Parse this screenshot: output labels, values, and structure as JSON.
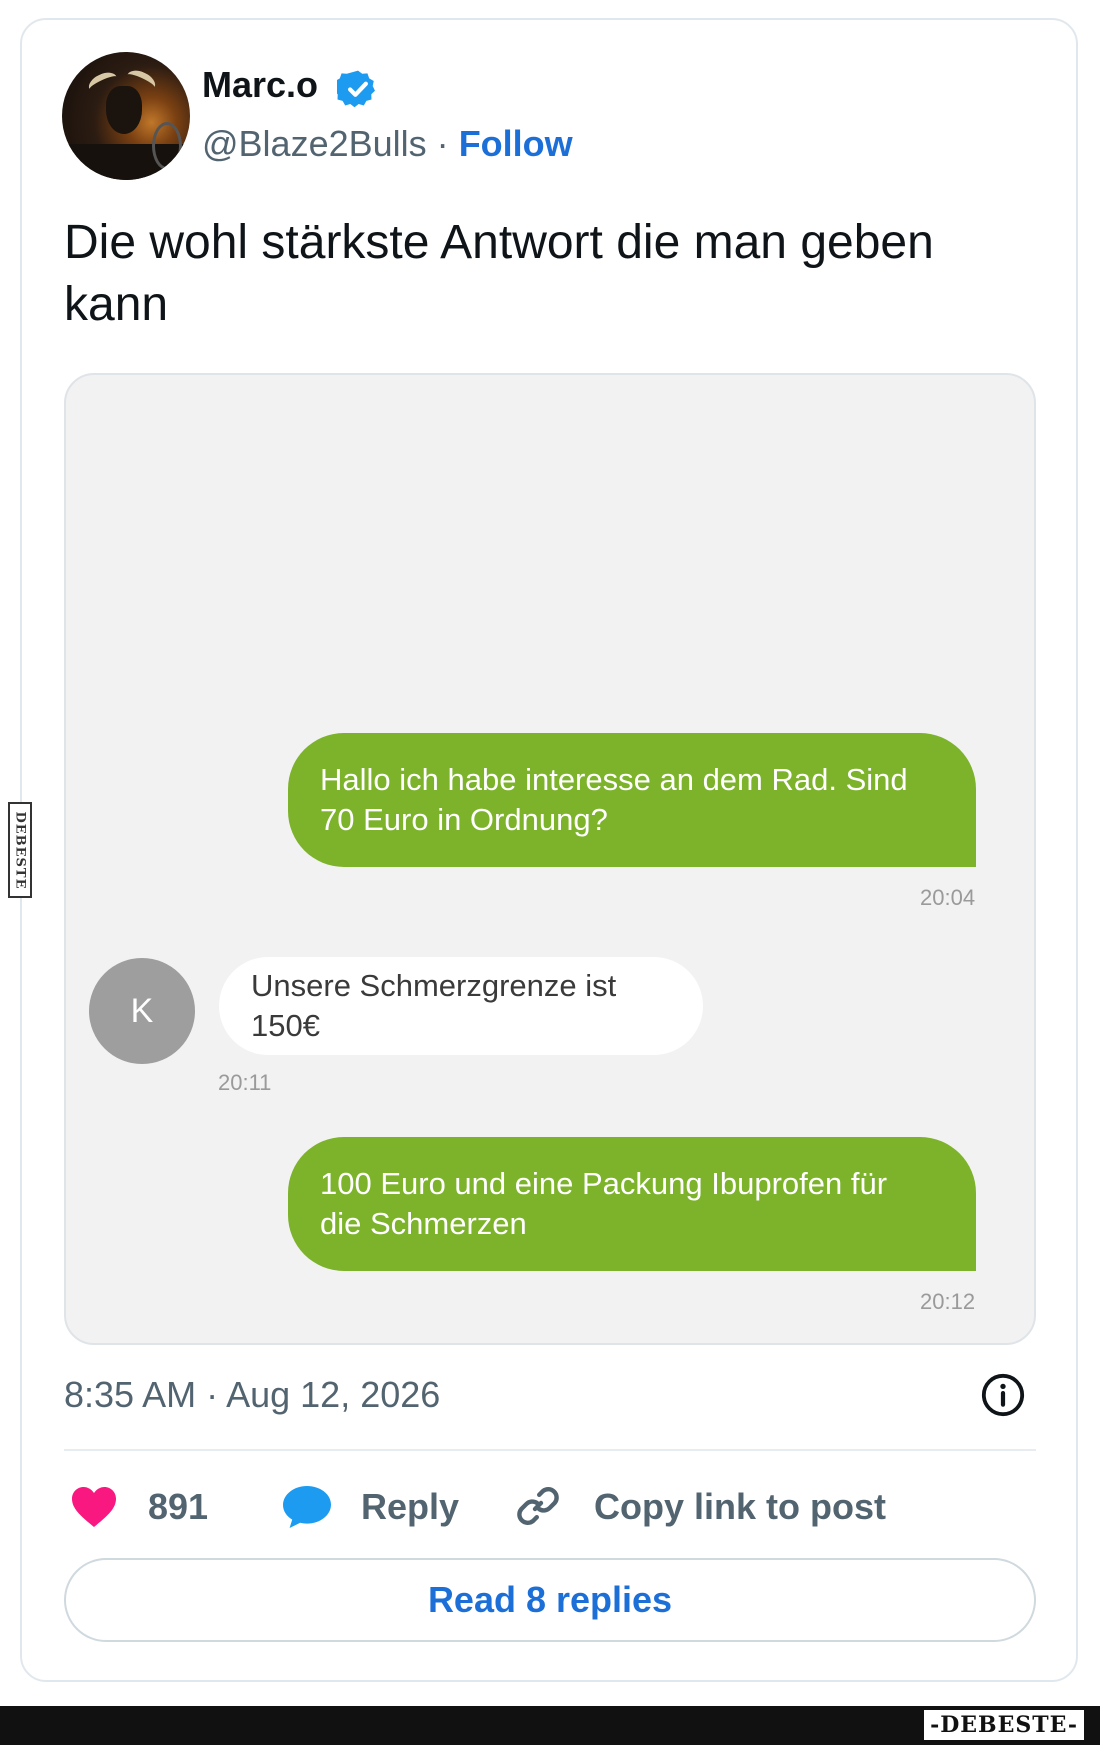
{
  "author": {
    "display_name": "Marc.o",
    "handle": "@Blaze2Bulls",
    "separator": "·",
    "follow_label": "Follow"
  },
  "tweet": {
    "text": "Die wohl stärkste Antwort die man geben kann",
    "timestamp": "8:35 AM · Aug 12, 2026"
  },
  "chat": {
    "messages": [
      {
        "direction": "outgoing",
        "text": "Hallo ich habe interesse an dem Rad. Sind 70 Euro in Ordnung?",
        "time": "20:04"
      },
      {
        "direction": "incoming",
        "sender_initial": "K",
        "text": "Unsere Schmerzgrenze ist 150€",
        "time": "20:11"
      },
      {
        "direction": "outgoing",
        "text": "100 Euro und eine Packung Ibuprofen für die Schmerzen",
        "time": "20:12"
      }
    ]
  },
  "actions": {
    "like_count": "891",
    "reply_label": "Reply",
    "copy_link_label": "Copy link to post",
    "read_replies_label": "Read 8 replies"
  },
  "watermark": {
    "side": "DEBESTE",
    "bottom": "-DEBESTE-"
  },
  "colors": {
    "accent_blue": "#1d6fd8",
    "bubble_green": "#7cb32a",
    "heart_pink": "#f91880",
    "reply_blue": "#1d9bf0"
  },
  "icons": [
    "verified-badge-icon",
    "info-icon",
    "heart-icon",
    "reply-bubble-icon",
    "link-icon"
  ]
}
